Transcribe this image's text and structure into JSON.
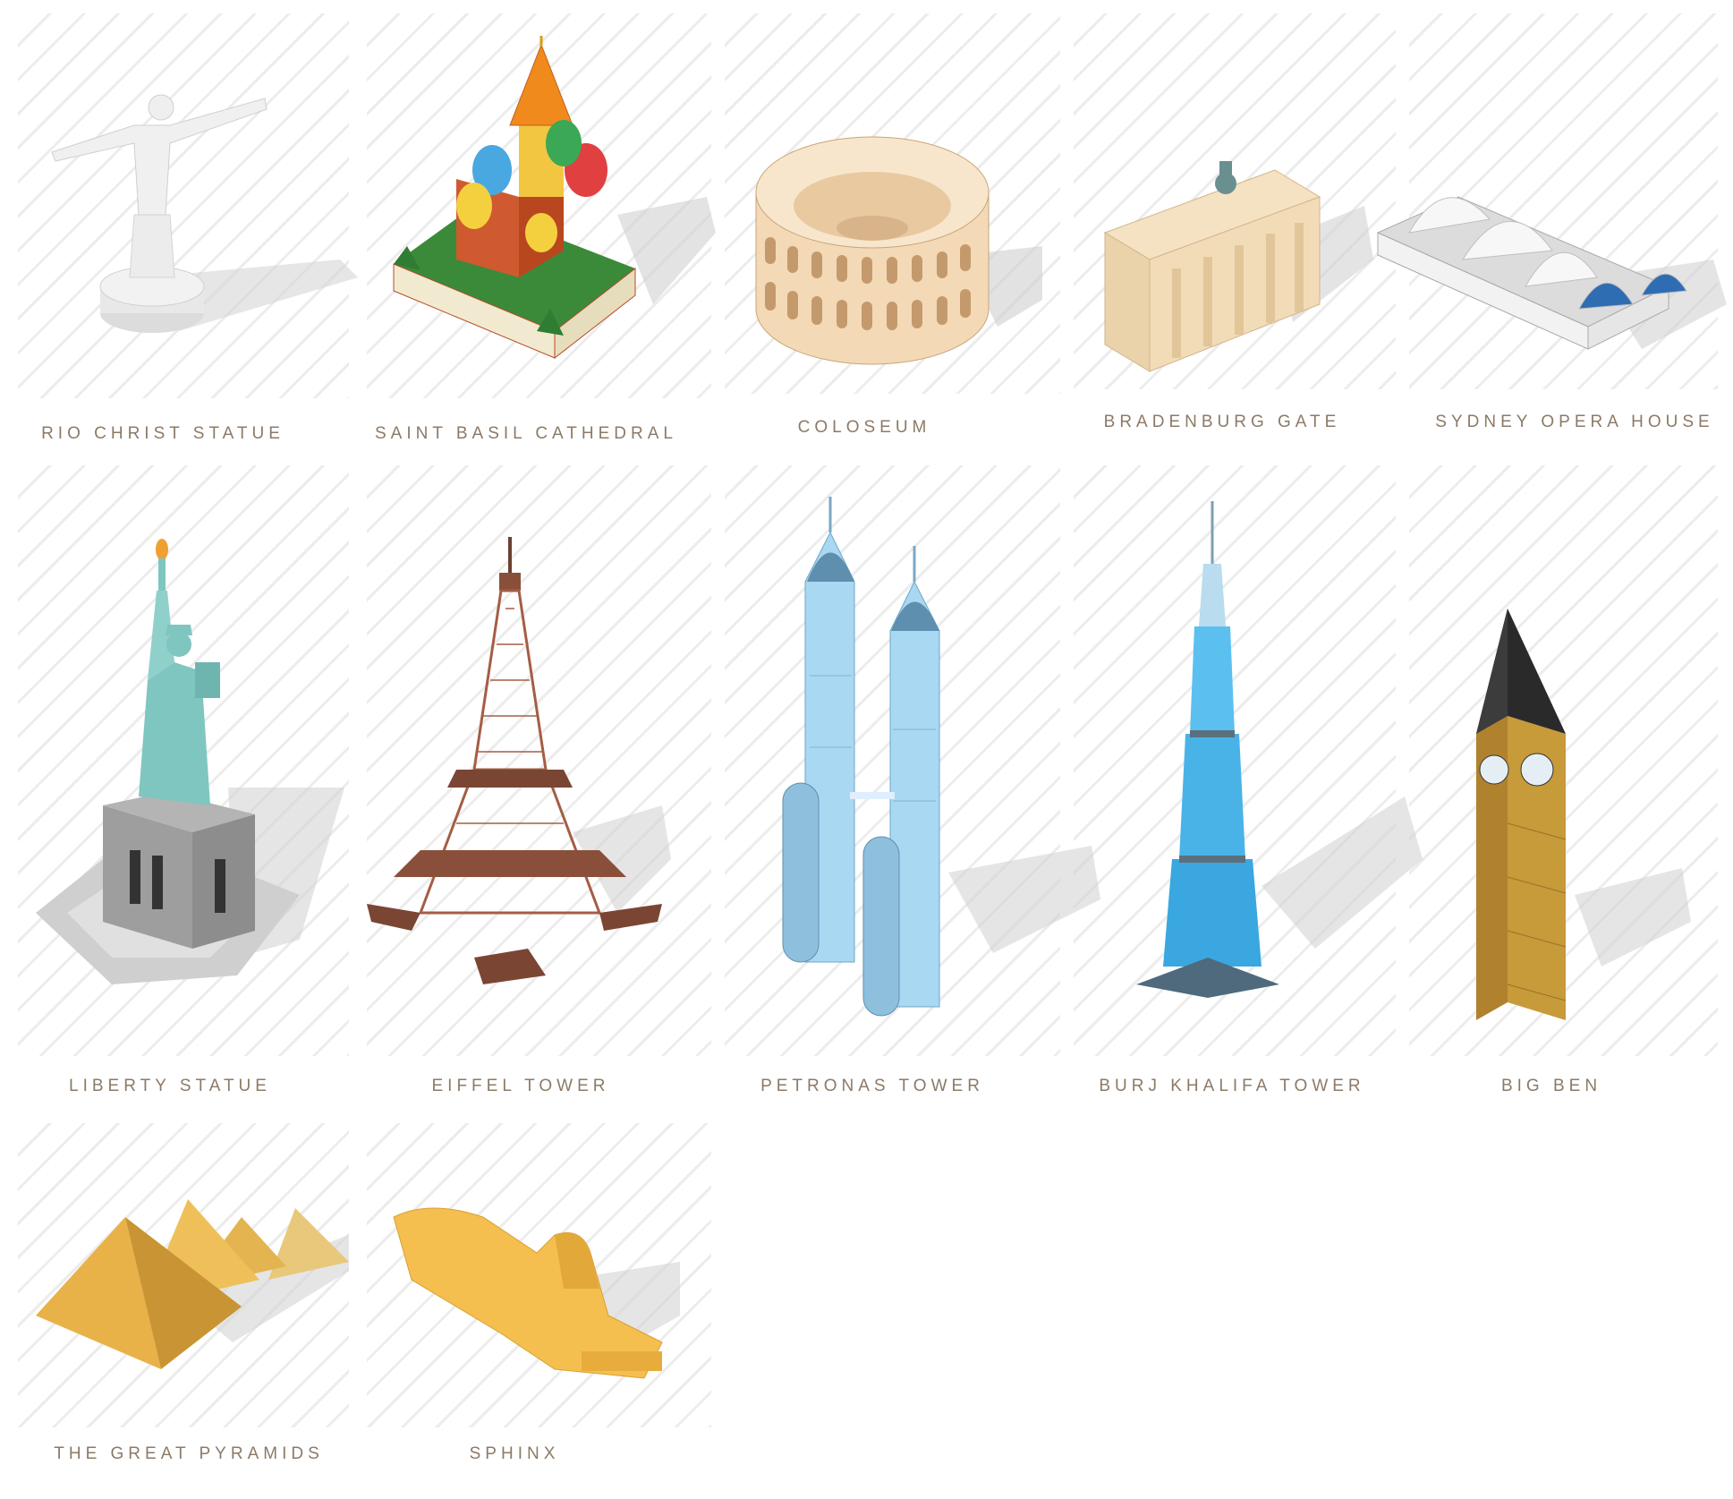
{
  "landmarks": [
    {
      "id": "rio",
      "label": "RIO CHRIST STATUE",
      "icon": "christ-redeemer-icon",
      "color": "#e2e2e2"
    },
    {
      "id": "basil",
      "label": "SAINT BASIL CATHEDRAL",
      "icon": "onion-dome-cathedral-icon",
      "color": "#c94a2a"
    },
    {
      "id": "colosseum",
      "label": "COLOSEUM",
      "icon": "colosseum-icon",
      "color": "#f3d9b6"
    },
    {
      "id": "brandenburg",
      "label": "BRADENBURG GATE",
      "icon": "brandenburg-gate-icon",
      "color": "#f2dcb8"
    },
    {
      "id": "sydney",
      "label": "SYDNEY OPERA HOUSE",
      "icon": "opera-house-icon",
      "color": "#f4f4f4"
    },
    {
      "id": "liberty",
      "label": "LIBERTY STATUE",
      "icon": "statue-of-liberty-icon",
      "color": "#7fc6c0"
    },
    {
      "id": "eiffel",
      "label": "EIFFEL TOWER",
      "icon": "eiffel-tower-icon",
      "color": "#9a5a45"
    },
    {
      "id": "petronas",
      "label": "PETRONAS TOWER",
      "icon": "twin-towers-icon",
      "color": "#9fd0ec"
    },
    {
      "id": "burj",
      "label": "BURJ KHALIFA TOWER",
      "icon": "skyscraper-icon",
      "color": "#5bc0f0"
    },
    {
      "id": "bigben",
      "label": "BIG BEN",
      "icon": "clock-tower-icon",
      "color": "#c79a3a"
    },
    {
      "id": "pyramids",
      "label": "THE GREAT PYRAMIDS",
      "icon": "pyramids-icon",
      "color": "#e3b44f"
    },
    {
      "id": "sphinx",
      "label": "SPHINX",
      "icon": "sphinx-icon",
      "color": "#f5bf4f"
    }
  ]
}
